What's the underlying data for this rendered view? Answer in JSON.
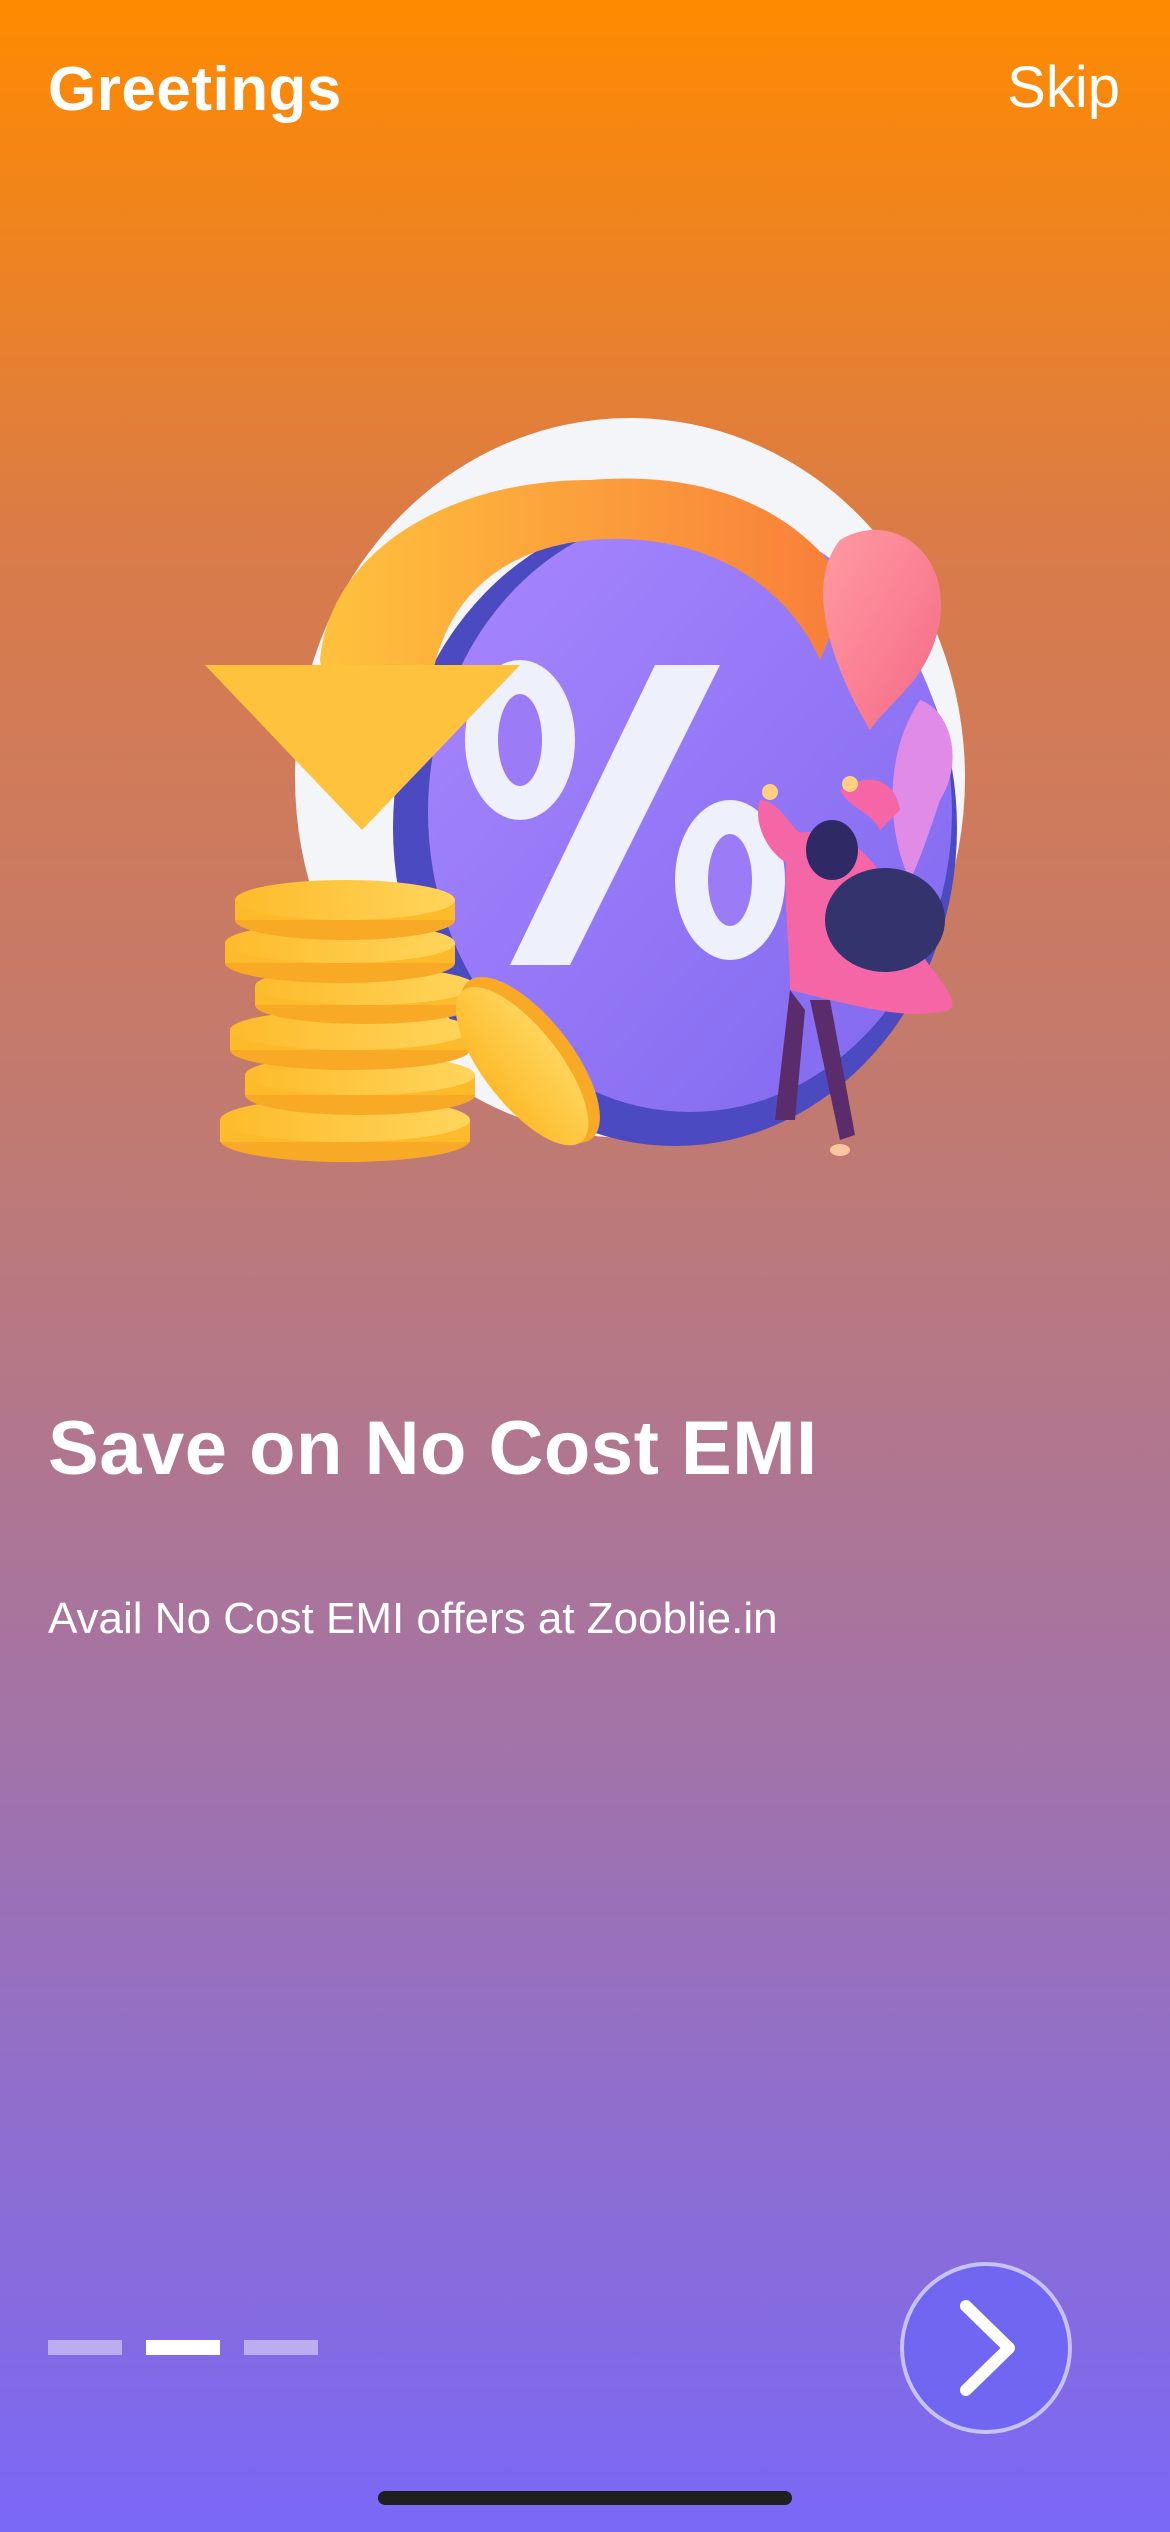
{
  "header": {
    "title": "Greetings",
    "skip_label": "Skip"
  },
  "slide": {
    "heading": "Save on No Cost EMI",
    "subtitle": "Avail No Cost EMI offers at Zooblie.in"
  },
  "pagination": {
    "total": 3,
    "active_index": 1
  },
  "icons": {
    "illustration": "discount-percent-illustration",
    "next": "chevron-right-icon"
  },
  "colors": {
    "gradient_top": "#ff8a00",
    "gradient_bottom": "#7a68f7",
    "button_fill": "#7066f2",
    "text": "#ffffff"
  }
}
